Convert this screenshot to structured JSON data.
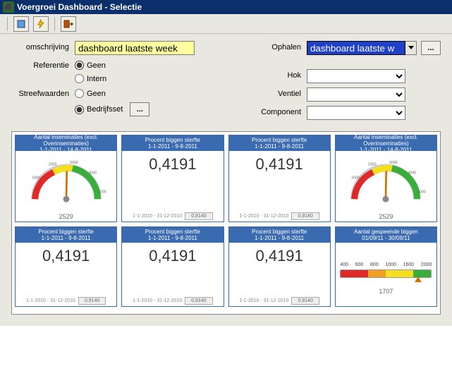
{
  "window": {
    "title": "Voergroei Dashboard - Selectie"
  },
  "toolbar": {
    "help_icon": "help-icon",
    "book_icon": "book-icon",
    "bolt_icon": "bolt-icon",
    "exit_icon": "exit-icon"
  },
  "form": {
    "omschrijving_label": "omschrijving",
    "omschrijving_value": "dashboard laatste week",
    "referentie_label": "Referentie",
    "ref_options": {
      "geen": "Geen",
      "intern": "Intern"
    },
    "ref_selected": "geen",
    "streefwaarden_label": "Streefwaarden",
    "streef_options": {
      "geen": "Geen",
      "bedrijfsset": "Bedrijfsset"
    },
    "streef_selected": "bedrijfsset",
    "ellipsis": "...",
    "ophalen_label": "Ophalen",
    "ophalen_value": "dashboard laatste w",
    "hok_label": "Hok",
    "hok_value": "",
    "ventiel_label": "Ventiel",
    "ventiel_value": "",
    "component_label": "Component",
    "component_value": ""
  },
  "dashboard": {
    "cards": [
      {
        "title1": "Aantal inseminaties (excl. Overinseminaties)",
        "title2": "1-1-2011 - 14-8-2011",
        "type": "gauge",
        "value": 2529,
        "min": 0,
        "max": 5000,
        "ticks": [
          "1000",
          "2000",
          "3000",
          "4000",
          "5000"
        ]
      },
      {
        "title1": "Procent biggen sterfte",
        "title2": "1-1-2011 - 9-8-2011",
        "type": "number",
        "value": "0,4191",
        "footer_date": "1-1-2010 - 31-12-2010",
        "footer_val": "0,9140"
      },
      {
        "title1": "Procent biggen sterfte",
        "title2": "1-1-2011 - 9-8-2011",
        "type": "number",
        "value": "0,4191",
        "footer_date": "1-1-2010 - 31-12-2010",
        "footer_val": "0,9140"
      },
      {
        "title1": "Aantal inseminaties (excl. Overinseminaties)",
        "title2": "1-1-2011 - 14-8-2011",
        "type": "gauge",
        "value": 2529,
        "min": 0,
        "max": 5000,
        "ticks": [
          "1000",
          "2000",
          "3000",
          "4000",
          "5000"
        ]
      },
      {
        "title1": "Procent biggen sterfte",
        "title2": "1-1-2011 - 9-8-2011",
        "type": "number",
        "value": "0,4191",
        "footer_date": "1-1-2010 - 31-12-2010",
        "footer_val": "0,9140"
      },
      {
        "title1": "Procent biggen sterfte",
        "title2": "1-1-2011 - 9-8-2011",
        "type": "number",
        "value": "0,4191",
        "footer_date": "1-1-2010 - 31-12-2010",
        "footer_val": "0,9140"
      },
      {
        "title1": "Procent biggen sterfte",
        "title2": "1-1-2011 - 9-8-2011",
        "type": "number",
        "value": "0,4191",
        "footer_date": "1-1-2010 - 31-12-2010",
        "footer_val": "0,9140"
      },
      {
        "title1": "Aantal gespeende biggen",
        "title2": "01/09/11 - 30/09/11",
        "type": "linear",
        "value": 1707,
        "min": 0,
        "max": 2000,
        "ticks": [
          "400",
          "600",
          "800",
          "1000",
          "1600",
          "2000"
        ]
      }
    ]
  },
  "chart_data": [
    {
      "type": "gauge",
      "title": "Aantal inseminaties (excl. Overinseminaties) 1-1-2011 - 14-8-2011",
      "value": 2529,
      "range": [
        0,
        5000
      ],
      "ticks": [
        1000,
        2000,
        3000,
        4000,
        5000
      ],
      "zones": [
        [
          0,
          2000,
          "red"
        ],
        [
          2000,
          3000,
          "yellow"
        ],
        [
          3000,
          5000,
          "green"
        ]
      ]
    },
    {
      "type": "gauge",
      "title": "Aantal inseminaties (excl. Overinseminaties) 1-1-2011 - 14-8-2011",
      "value": 2529,
      "range": [
        0,
        5000
      ],
      "ticks": [
        1000,
        2000,
        3000,
        4000,
        5000
      ],
      "zones": [
        [
          0,
          2000,
          "red"
        ],
        [
          2000,
          3000,
          "yellow"
        ],
        [
          3000,
          5000,
          "green"
        ]
      ]
    },
    {
      "type": "linear-gauge",
      "title": "Aantal gespeende biggen 01/09/11 - 30/09/11",
      "value": 1707,
      "range": [
        0,
        2000
      ],
      "ticks": [
        400,
        600,
        800,
        1000,
        1600,
        2000
      ],
      "zones": [
        [
          0,
          600,
          "red"
        ],
        [
          600,
          1000,
          "orange"
        ],
        [
          1000,
          1600,
          "yellow"
        ],
        [
          1600,
          2000,
          "green"
        ]
      ]
    }
  ]
}
